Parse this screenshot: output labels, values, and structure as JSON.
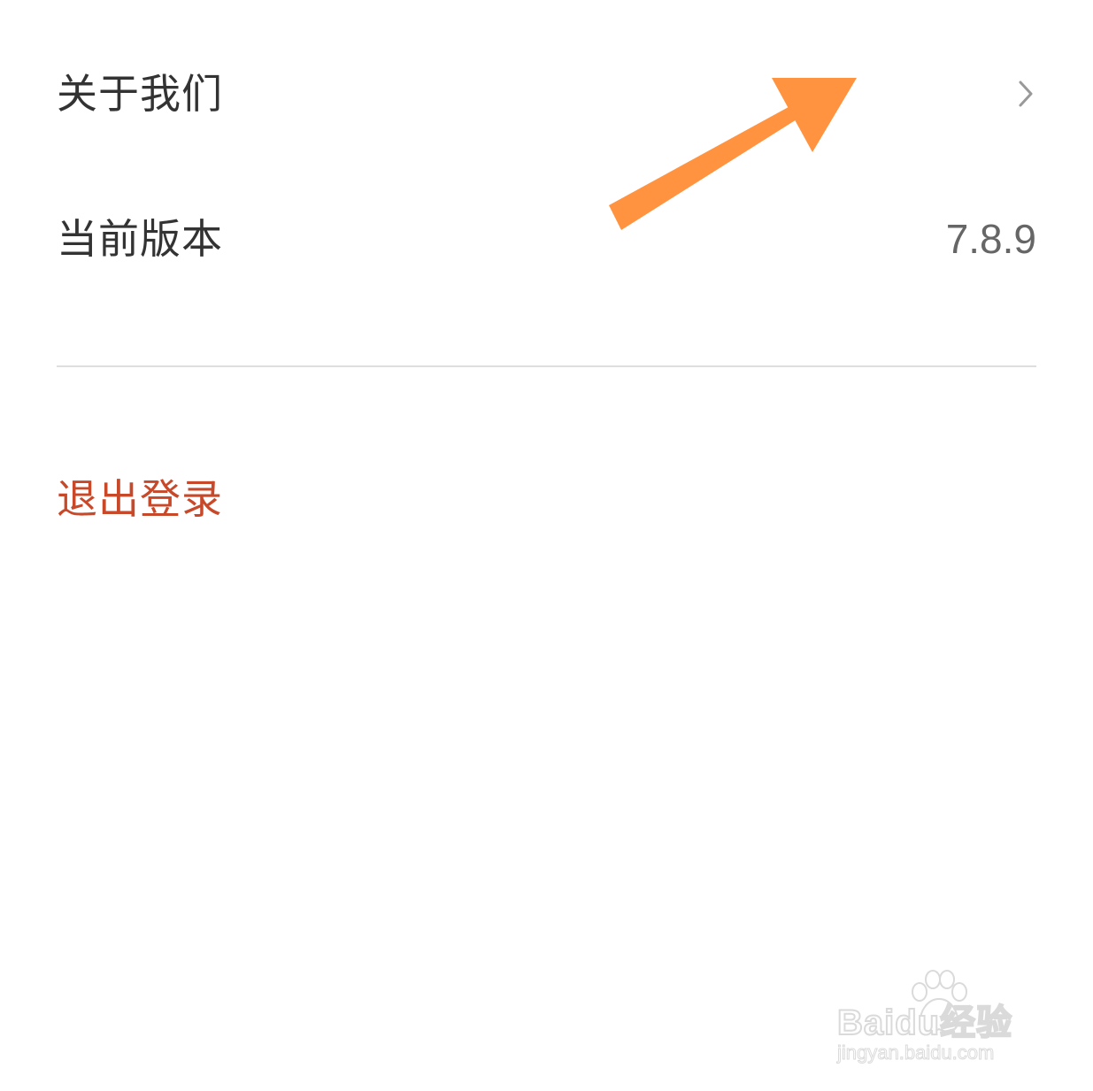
{
  "settings": {
    "about_us_label": "关于我们",
    "current_version_label": "当前版本",
    "current_version_value": "7.8.9",
    "logout_label": "退出登录"
  },
  "icons": {
    "chevron": "chevron-right-icon",
    "annotation": "orange-arrow-icon",
    "watermark": "baidu-paw-icon"
  },
  "colors": {
    "logout": "#c8482a",
    "annotation_arrow": "#ff9340",
    "chevron": "#999999",
    "divider": "#dedede"
  },
  "watermark": {
    "brand": "Baidu经验",
    "url": "jingyan.baidu.com"
  }
}
